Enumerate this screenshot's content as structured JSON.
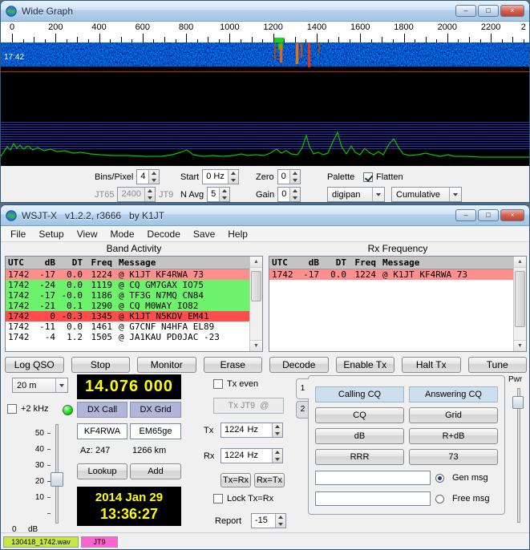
{
  "wide_graph": {
    "title": "Wide Graph",
    "time_label": "17:42",
    "scale_ticks": [
      "0",
      "200",
      "400",
      "600",
      "800",
      "1000",
      "1200",
      "1400",
      "1600",
      "1800",
      "2000",
      "2200",
      "2"
    ],
    "controls": {
      "bins_label": "Bins/Pixel",
      "bins_value": "4",
      "start_label": "Start",
      "start_value": "0 Hz",
      "zero_label": "Zero",
      "zero_value": "0",
      "palette_label": "Palette",
      "flatten_label": "Flatten",
      "jt65_label": "JT65",
      "split_value": "2400",
      "jt9_label": "JT9",
      "navg_label": "N Avg",
      "navg_value": "5",
      "gain_label": "Gain",
      "gain_value": "0",
      "palette_value": "digipan",
      "display_mode": "Cumulative"
    }
  },
  "wsjtx": {
    "title": "WSJT-X   v1.2.2, r3666   by K1JT",
    "menus": [
      "File",
      "Setup",
      "View",
      "Mode",
      "Decode",
      "Save",
      "Help"
    ],
    "band_activity": {
      "title": "Band Activity",
      "header": {
        "utc": "UTC",
        "db": "dB",
        "dt": "DT",
        "freq": "Freq",
        "msg": "Message"
      },
      "rows": [
        {
          "utc": "1742",
          "db": "-17",
          "dt": "0.0",
          "freq": "1224",
          "msg": "@ K1JT KF4RWA 73",
          "hl": "pink"
        },
        {
          "utc": "1742",
          "db": "-24",
          "dt": "0.0",
          "freq": "1119",
          "msg": "@ CQ GM7GAX IO75",
          "hl": "green"
        },
        {
          "utc": "1742",
          "db": "-17",
          "dt": "-0.0",
          "freq": "1186",
          "msg": "@ TF3G N7MQ CN84",
          "hl": "green"
        },
        {
          "utc": "1742",
          "db": "-21",
          "dt": "0.1",
          "freq": "1290",
          "msg": "@ CQ M0WAY IO82",
          "hl": "green"
        },
        {
          "utc": "1742",
          "db": "0",
          "dt": "-0.3",
          "freq": "1345",
          "msg": "@ K1JT N5KDV EM41",
          "hl": "red"
        },
        {
          "utc": "1742",
          "db": "-11",
          "dt": "0.0",
          "freq": "1461",
          "msg": "@ G7CNF N4HFA EL89",
          "hl": "none"
        },
        {
          "utc": "1742",
          "db": "-4",
          "dt": "1.2",
          "freq": "1505",
          "msg": "@ JA1KAU PD0JAC -23",
          "hl": "none"
        }
      ]
    },
    "rx_frequency": {
      "title": "Rx Frequency",
      "header": {
        "utc": "UTC",
        "db": "dB",
        "dt": "DT",
        "freq": "Freq",
        "msg": "Message"
      },
      "rows": [
        {
          "utc": "1742",
          "db": "-17",
          "dt": "0.0",
          "freq": "1224",
          "msg": "@ K1JT KF4RWA 73",
          "hl": "pink"
        }
      ]
    },
    "buttons": [
      "Log QSO",
      "Stop",
      "Monitor",
      "Erase",
      "Decode",
      "Enable Tx",
      "Halt Tx",
      "Tune"
    ],
    "left": {
      "band": "20 m",
      "frequency": "14.076 000",
      "plus2khz": "+2 kHz",
      "dx_call_label": "DX Call",
      "dx_grid_label": "DX Grid",
      "dx_call": "KF4RWA",
      "dx_grid": "EM65ge",
      "az": "Az: 247",
      "distance": "1266 km",
      "lookup": "Lookup",
      "add": "Add",
      "slider_labels": [
        "50",
        "40",
        "30",
        "20",
        "10"
      ],
      "slider_zero": "0",
      "slider_unit": "dB",
      "date": "2014 Jan 29",
      "time": "13:36:27"
    },
    "middle": {
      "tx_even": "Tx even",
      "tx_mode": "Tx JT9  @",
      "tx_label": "Tx",
      "tx_freq": "1224",
      "tx_unit": "Hz",
      "rx_label": "Rx",
      "rx_freq": "1224",
      "rx_unit": "Hz",
      "tx_eq_rx": "Tx=Rx",
      "rx_eq_tx": "Rx=Tx",
      "lock": "Lock Tx=Rx",
      "report_label": "Report",
      "report_value": "-15"
    },
    "right": {
      "tabs": [
        "1",
        "2"
      ],
      "col1_header": "Calling CQ",
      "col2_header": "Answering CQ",
      "buttons": [
        [
          "CQ",
          "Grid"
        ],
        [
          "dB",
          "R+dB"
        ],
        [
          "RRR",
          "73"
        ]
      ],
      "gen_msg": "Gen msg",
      "free_msg": "Free msg",
      "pwr": "Pwr"
    },
    "status": {
      "wav": "130418_1742.wav",
      "mode": "JT9"
    }
  },
  "colors": {
    "row_highlight": {
      "green": "#6ef26e",
      "pink": "#ff8e8e",
      "red": "#ff4d4d",
      "none": "#ffffff"
    },
    "display_text": "#ffff00",
    "display_bg": "#000000",
    "status_wav_bg": "#c6e645",
    "status_mode_bg": "#ff63d1",
    "dx_button_bg": "#b2b5da",
    "led_green": "#27d427",
    "marker_green": "#17d617",
    "spectrum_line": "#00c800"
  }
}
